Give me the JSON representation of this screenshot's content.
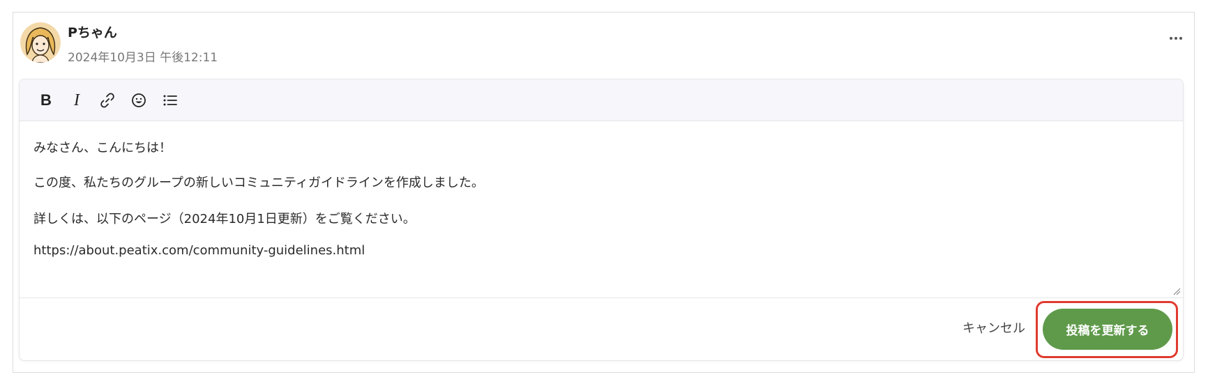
{
  "post": {
    "author": "Pちゃん",
    "timestamp": "2024年10月3日 午後12:11",
    "more_icon": "more-horizontal-icon"
  },
  "toolbar": {
    "bold_label": "B",
    "italic_label": "I",
    "link_icon": "link-icon",
    "emoji_icon": "emoji-icon",
    "list_icon": "bulleted-list-icon"
  },
  "editor": {
    "paragraphs": [
      "みなさん、こんにちは！",
      "この度、私たちのグループの新しいコミュニティガイドラインを作成しました。",
      "詳しくは、以下のページ（2024年10月1日更新）をご覧ください。",
      "https://about.peatix.com/community-guidelines.html"
    ]
  },
  "actions": {
    "cancel_label": "キャンセル",
    "update_label": "投稿を更新する"
  },
  "colors": {
    "accent": "#5f9a4b",
    "highlight": "#e03a2f",
    "toolbar_bg": "#f6f6fb"
  }
}
